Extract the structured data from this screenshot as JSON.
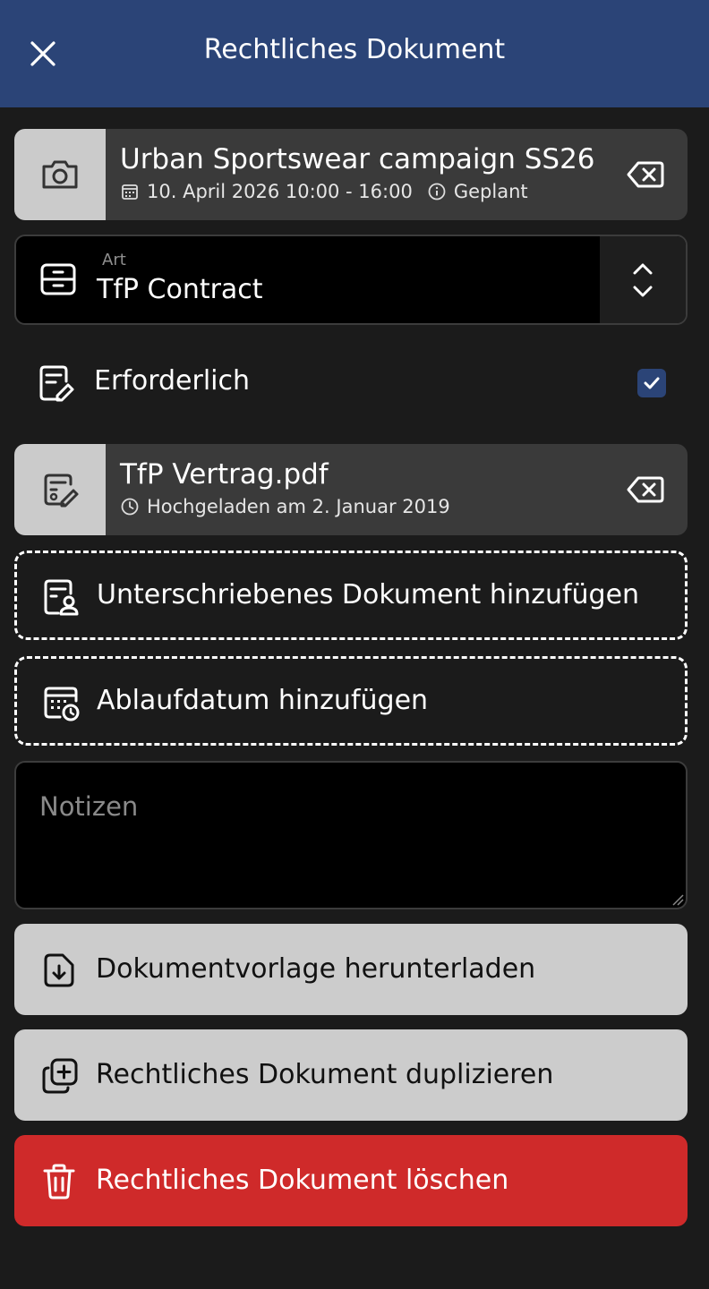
{
  "header": {
    "title": "Rechtliches Dokument",
    "close_icon": "close-icon"
  },
  "event_card": {
    "title": "Urban Sportswear campaign SS26",
    "date": "10. April 2026 10:00 - 16:00",
    "status": "Geplant",
    "thumb_icon": "camera-icon"
  },
  "type_select": {
    "label": "Art",
    "value": "TfP Contract"
  },
  "required": {
    "label": "Erforderlich",
    "checked": true
  },
  "file_card": {
    "filename": "TfP Vertrag.pdf",
    "uploaded": "Hochgeladen am 2. Januar 2019"
  },
  "actions": {
    "add_signed": "Unterschriebenes Dokument hinzufügen",
    "add_expiry": "Ablaufdatum hinzufügen"
  },
  "notes": {
    "placeholder": "Notizen"
  },
  "buttons": {
    "download_template": "Dokumentvorlage herunterladen",
    "duplicate": "Rechtliches Dokument duplizieren",
    "delete": "Rechtliches Dokument löschen"
  },
  "colors": {
    "header_bg": "#2b4477",
    "background": "#1b1b1b",
    "danger": "#cf2a2a",
    "button_bg": "#cccccc"
  }
}
